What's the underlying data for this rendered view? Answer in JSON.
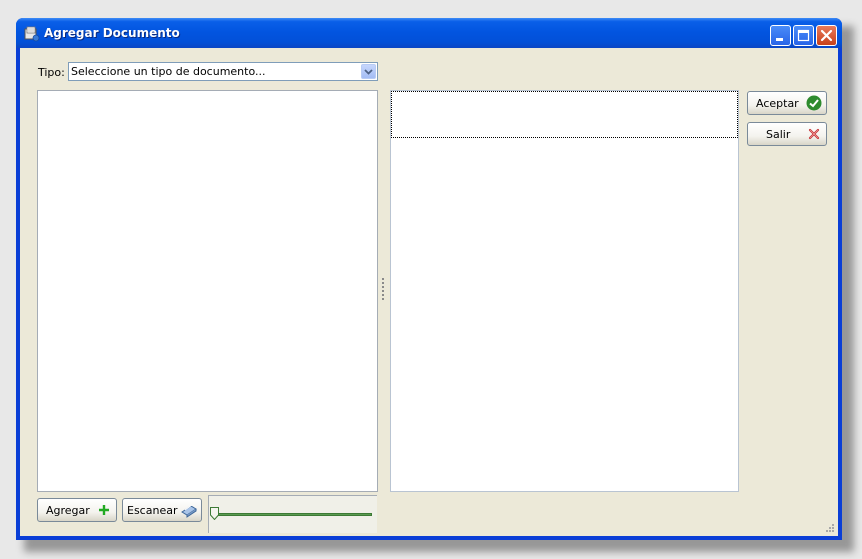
{
  "window": {
    "title": "Agregar Documento",
    "controls": [
      "minimize-icon",
      "maximize-icon",
      "close-icon"
    ]
  },
  "form": {
    "tipo_label": "Tipo:",
    "tipo_value": "Seleccione un tipo de documento..."
  },
  "buttons": {
    "aceptar": "Aceptar",
    "salir": "Salir",
    "agregar": "Agregar",
    "escanear": "Escanear"
  },
  "slider": {
    "value": 0
  },
  "colors": {
    "titlebar": "#0255e0",
    "client_bg": "#ece9d8",
    "aceptar_icon": "#2e8b2e",
    "salir_icon": "#c0282a",
    "agregar_icon": "#22aa22"
  }
}
